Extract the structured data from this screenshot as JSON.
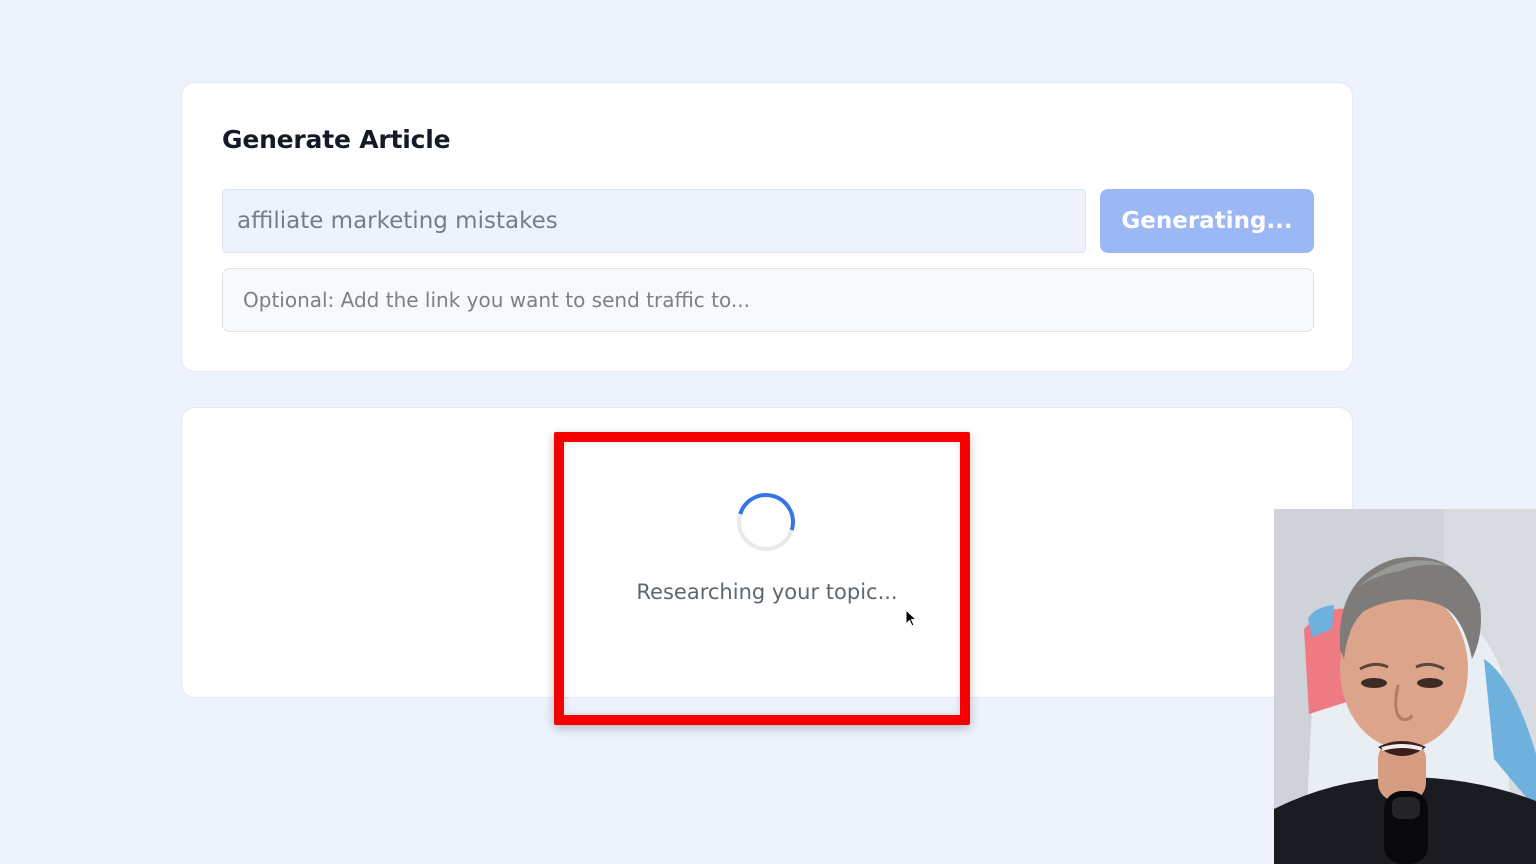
{
  "form": {
    "title": "Generate Article",
    "topic_input": {
      "value": "affiliate marketing mistakes"
    },
    "generate_button": {
      "label": "Generating...",
      "disabled": true,
      "color": "#9cb8f4"
    },
    "link_input": {
      "placeholder": "Optional: Add the link you want to send traffic to...",
      "value": ""
    }
  },
  "status": {
    "message": "Researching your topic...",
    "spinner_color": "#3874e8"
  },
  "highlight": {
    "color": "#f50000"
  },
  "icons": {
    "spinner": "loading-spinner-icon",
    "cursor": "mouse-pointer-icon"
  }
}
